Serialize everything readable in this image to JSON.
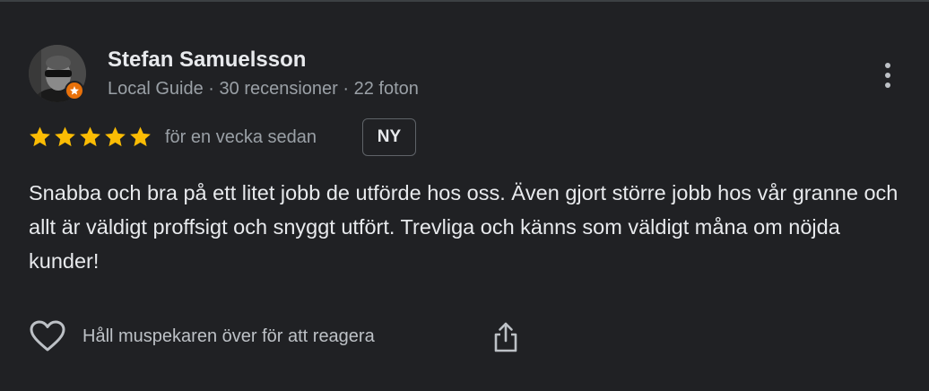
{
  "author": {
    "name": "Stefan Samuelsson",
    "meta": "Local Guide · 30 recensioner · 22 foton",
    "avatar_icon": "user-photo",
    "badge_icon": "local-guide-star-icon",
    "badge_color": "#e8710a"
  },
  "rating": {
    "stars": 5,
    "max": 5,
    "star_color": "#fbbc04"
  },
  "review": {
    "time": "för en vecka sedan",
    "badge": "NY",
    "text": "Snabba och bra på ett litet jobb de utförde hos oss. Även gjort större jobb hos vår granne och allt är väldigt proffsigt och snyggt utfört. Trevliga och känns som väldigt måna om nöjda kunder!"
  },
  "actions": {
    "like_icon": "heart-outline-icon",
    "react_hint": "Håll muspekaren över för att reagera",
    "share_icon": "share-icon",
    "more_icon": "more-vertical-icon"
  }
}
